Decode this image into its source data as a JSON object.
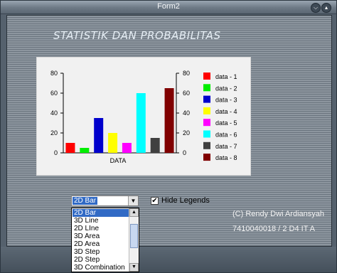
{
  "window": {
    "title": "Form2"
  },
  "heading": "STATISTIK DAN PROBABILITAS",
  "chart_data": {
    "type": "bar",
    "xlabel": "DATA",
    "ylim": [
      0,
      80
    ],
    "yticks": [
      "0",
      "20",
      "40",
      "60",
      "80"
    ],
    "legend": "right",
    "series": [
      {
        "name": "data - 1",
        "value": 10,
        "color": "#ff0000"
      },
      {
        "name": "data - 2",
        "value": 5,
        "color": "#00ee00"
      },
      {
        "name": "data - 3",
        "value": 35,
        "color": "#0000cc"
      },
      {
        "name": "data - 4",
        "value": 20,
        "color": "#ffff00"
      },
      {
        "name": "data - 5",
        "value": 10,
        "color": "#ff00ff"
      },
      {
        "name": "data - 6",
        "value": 60,
        "color": "#00ffff"
      },
      {
        "name": "data - 7",
        "value": 15,
        "color": "#404040"
      },
      {
        "name": "data - 8",
        "value": 65,
        "color": "#800000"
      }
    ]
  },
  "chart_type_select": {
    "value": "2D Bar",
    "options": [
      "2D Bar",
      "3D Line",
      "2D LIne",
      "3D Area",
      "2D Area",
      "3D Step",
      "2D Step",
      "3D Combination"
    ],
    "selected_index": 0
  },
  "hide_legends": {
    "label": "Hide Legends",
    "checked": true
  },
  "credits": {
    "line1": "(C) Rendy Dwi Ardiansyah",
    "line2": "7410040018 / 2 D4 IT A"
  }
}
